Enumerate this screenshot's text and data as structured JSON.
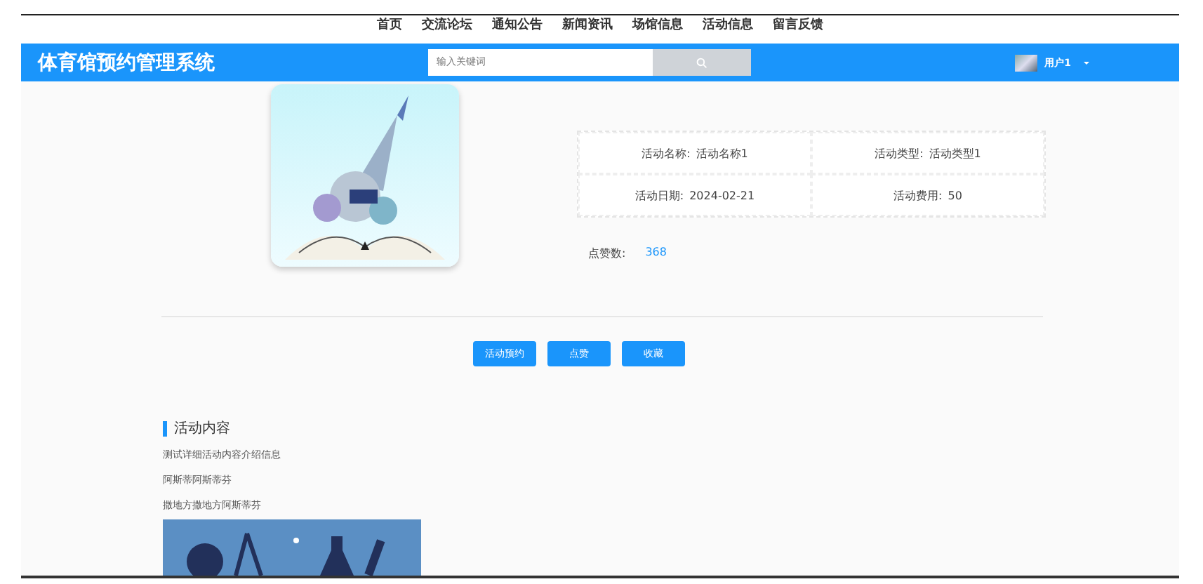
{
  "nav": [
    "首页",
    "交流论坛",
    "通知公告",
    "新闻资讯",
    "场馆信息",
    "活动信息",
    "留言反馈"
  ],
  "header": {
    "title": "体育馆预约管理系统",
    "search": {
      "placeholder": "输入关键词"
    },
    "user": "用户1"
  },
  "details": [
    {
      "label": "活动名称:",
      "value": "活动名称1"
    },
    {
      "label": "活动类型:",
      "value": "活动类型1"
    },
    {
      "label": "活动日期:",
      "value": "2024-02-21"
    },
    {
      "label": "活动费用:",
      "value": "50"
    }
  ],
  "likes": {
    "label": "点赞数:",
    "value": "368"
  },
  "buttons": [
    "活动预约",
    "点赞",
    "收藏"
  ],
  "content": {
    "title": "活动内容",
    "paragraphs": [
      "测试详细活动内容介绍信息",
      "阿斯蒂阿斯蒂芬",
      "撒地方撒地方阿斯蒂芬"
    ]
  }
}
